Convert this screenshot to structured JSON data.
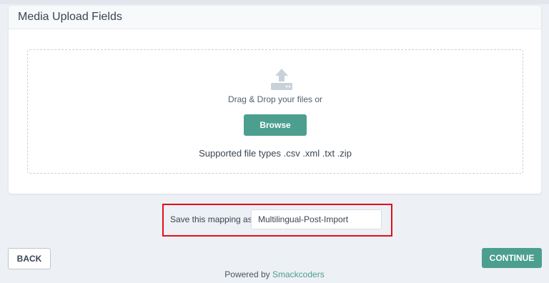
{
  "card": {
    "title": "Media Upload Fields",
    "dropzone": {
      "icon": "upload-icon",
      "drag_text": "Drag & Drop your files or",
      "browse_label": "Browse",
      "supported_types": "Supported file types .csv .xml .txt .zip"
    }
  },
  "mapping": {
    "label": "Save this mapping as",
    "value": "Multilingual-Post-Import"
  },
  "actions": {
    "back_label": "BACK",
    "continue_label": "CONTINUE"
  },
  "footer": {
    "prefix": "Powered by",
    "brand": "Smackcoders"
  },
  "colors": {
    "accent": "#4c9f8e",
    "highlight_border": "#e0101a",
    "background": "#edf0f4"
  }
}
